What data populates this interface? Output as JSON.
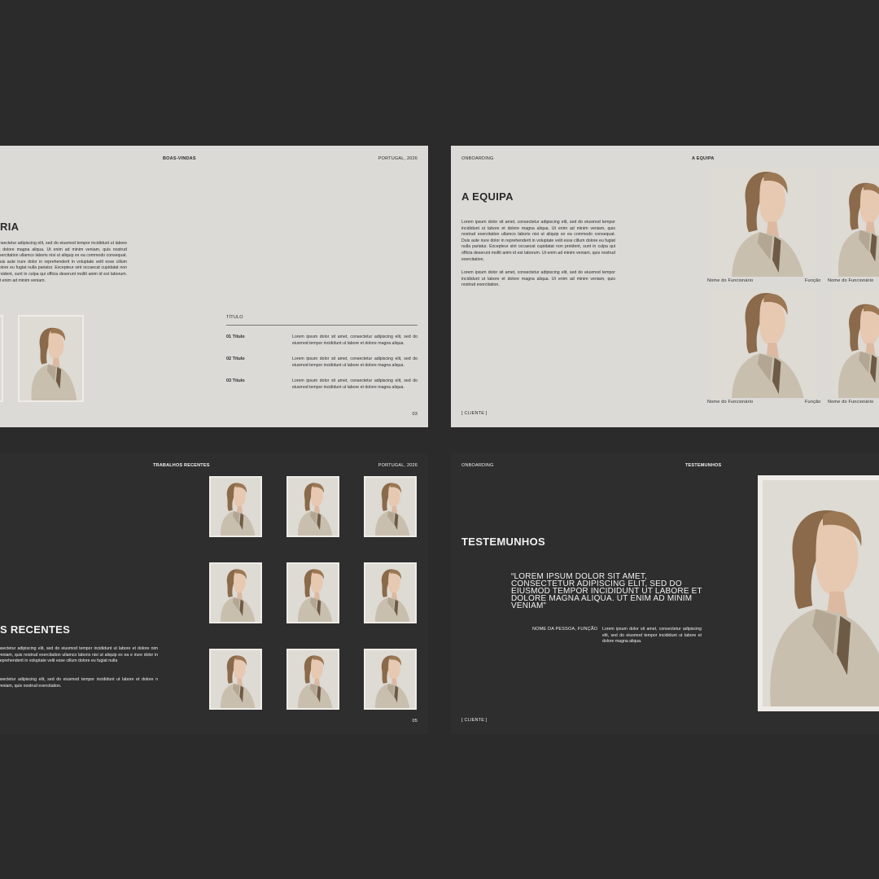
{
  "slides": {
    "welcome": {
      "header_left": "BOAS-VINDAS",
      "header_right": "PORTUGAL, 2026",
      "title_fragment": "RIA",
      "paragraph": "onsectetur adipiscing elit, sed do eiusmod tempor incididunt ut labore et dolore magna aliqua. Ut enim ad minim veniam, quis nostrud exercitation ullamco laboris nisi ut aliquip ex ea commodo consequat. Duis aute irure dolor in reprehenderit in voluptate velit esse cillum dolore eu fugiat nulla pariatur. Excepteur sint occaecat cupidatat non proident, sunt in culpa qui officia deserunt mollit anim id est laborum. Ut enim ad minim veniam.",
      "list_header": "TÍTULO",
      "items": [
        {
          "title": "01 Título",
          "text": "Lorem ipsum dolor sit amet, consectetur adipiscing elit, sed do eiusmod tempor incididunt ut labore et dolore magna aliqua."
        },
        {
          "title": "02 Título",
          "text": "Lorem ipsum dolor sit amet, consectetur adipiscing elit, sed do eiusmod tempor incididunt ut labore et dolore magna aliqua."
        },
        {
          "title": "03 Título",
          "text": "Lorem ipsum dolor sit amet, consectetur adipiscing elit, sed do eiusmod tempor incididunt ut labore et dolore magna aliqua."
        }
      ],
      "page_number": "03"
    },
    "team": {
      "header_left": "ONBOARDING",
      "header_center": "A EQUIPA",
      "title": "A EQUIPA",
      "paragraph1": "Lorem ipsum dolor sit amet, consectetur adipiscing elit, sed do eiusmod tempor incididunt ut labore et dolore magna aliqua. Ut enim ad minim veniam, quis nostrud exercitation ullamco laboris nisi ut aliquip ex ea commodo consequat. Duis aute irure dolor in reprehenderit in voluptate velit esse cillum dolore eu fugiat nulla pariatur. Excepteur sint occaecat cupidatat non proident, sunt in culpa qui officia deserunt mollit anim id est laborum. Ut enim ad minim veniam, quis nostrud exercitation.",
      "paragraph2": "Lorem ipsum dolor sit amet, consectetur adipiscing elit, sed do eiusmod tempor incididunt ut labore et dolore magna aliqua. Ut enim ad minim veniam, quis nostrud exercitation.",
      "members": [
        {
          "name": "Nome do Funcionário",
          "role": "Função"
        },
        {
          "name": "Nome do Funcionário",
          "role": ""
        },
        {
          "name": "Nome do Funcionário",
          "role": "Função"
        },
        {
          "name": "Nome do Funcionário",
          "role": ""
        }
      ],
      "footer": "[ CLIENTE ]"
    },
    "works": {
      "header_center": "TRABALHOS RECENTES",
      "header_right": "PORTUGAL, 2026",
      "title_fragment": "S RECENTES",
      "paragraph1": "nsectetur adipiscing elit, sed do eiusmod tempor incididunt ut labore et dolore nim veniam, quis nostrud exercitation ullamco laboris nisi ut aliquip ex ea e irure dolor in reprehenderit in voluptate velit esse cillum dolore eu fugiat nulla",
      "paragraph2": "nsectetur adipiscing elit, sed do eiusmod tempor incididunt ut labore et dolore n veniam, quis nostrud exercitation.",
      "page_number": "05"
    },
    "testimonials": {
      "header_left": "ONBOARDING",
      "header_center": "TESTEMUNHOS",
      "title": "TESTEMUNHOS",
      "quote": "“LOREM IPSUM DOLOR SIT AMET, CONSECTETUR ADIPISCING ELIT, SED DO EIUSMOD TEMPOR INCIDIDUNT UT LABORE ET DOLORE MAGNA ALIQUA. UT ENIM AD MINIM VENIAM”",
      "person": "NOME DA PESSOA, FUNÇÃO",
      "text": "Lorem ipsum dolor sit amet, consectetur adipiscing elit, sed do eiusmod tempor incididunt ut labore et dolore magna aliqua.",
      "footer": "[ CLIENTE ]"
    }
  },
  "colors": {
    "background": "#2b2b2b",
    "light_slide": "#dcdad6",
    "dark_slide": "#2e2e2e",
    "coat": "#c9bfae",
    "hair": "#8a6a4a"
  },
  "icons": [
    "portrait-photo"
  ]
}
